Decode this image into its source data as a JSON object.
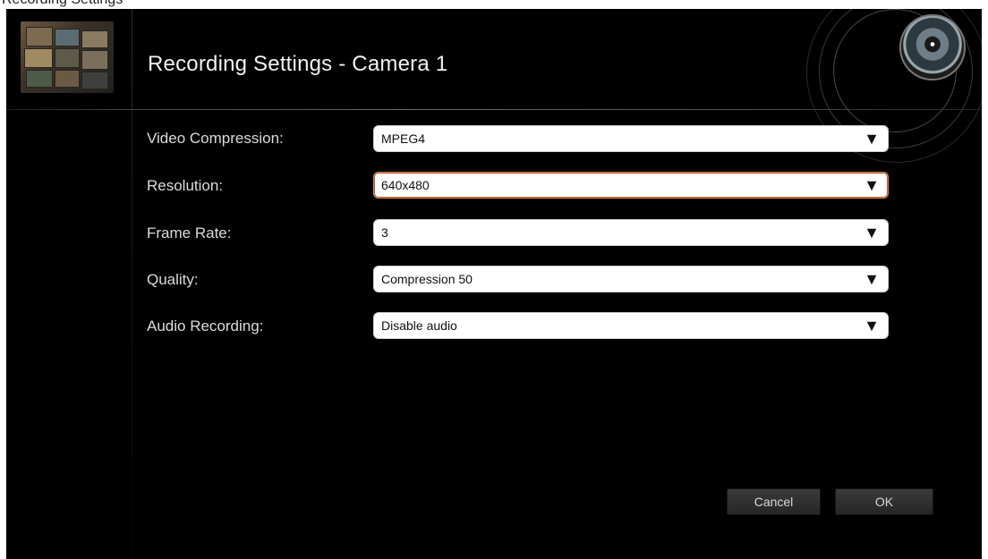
{
  "window": {
    "cut_off_title": "Recording Settings"
  },
  "dialog": {
    "title": "Recording Settings - Camera 1"
  },
  "fields": [
    {
      "label": "Video Compression:",
      "value": "MPEG4"
    },
    {
      "label": "Resolution:",
      "value": "640x480",
      "focused": true
    },
    {
      "label": "Frame Rate:",
      "value": "3"
    },
    {
      "label": "Quality:",
      "value": "Compression 50"
    },
    {
      "label": "Audio Recording:",
      "value": "Disable audio"
    }
  ],
  "dropdown_arrow": "▼",
  "buttons": {
    "cancel": "Cancel",
    "ok": "OK"
  },
  "icons": {
    "camera_wall_thumbnail": "camera-wall-icon",
    "camera_lens": "camera-lens-icon"
  },
  "colors": {
    "background": "#000000",
    "text": "#dcdcdc",
    "focus_border": "#d98a52"
  }
}
